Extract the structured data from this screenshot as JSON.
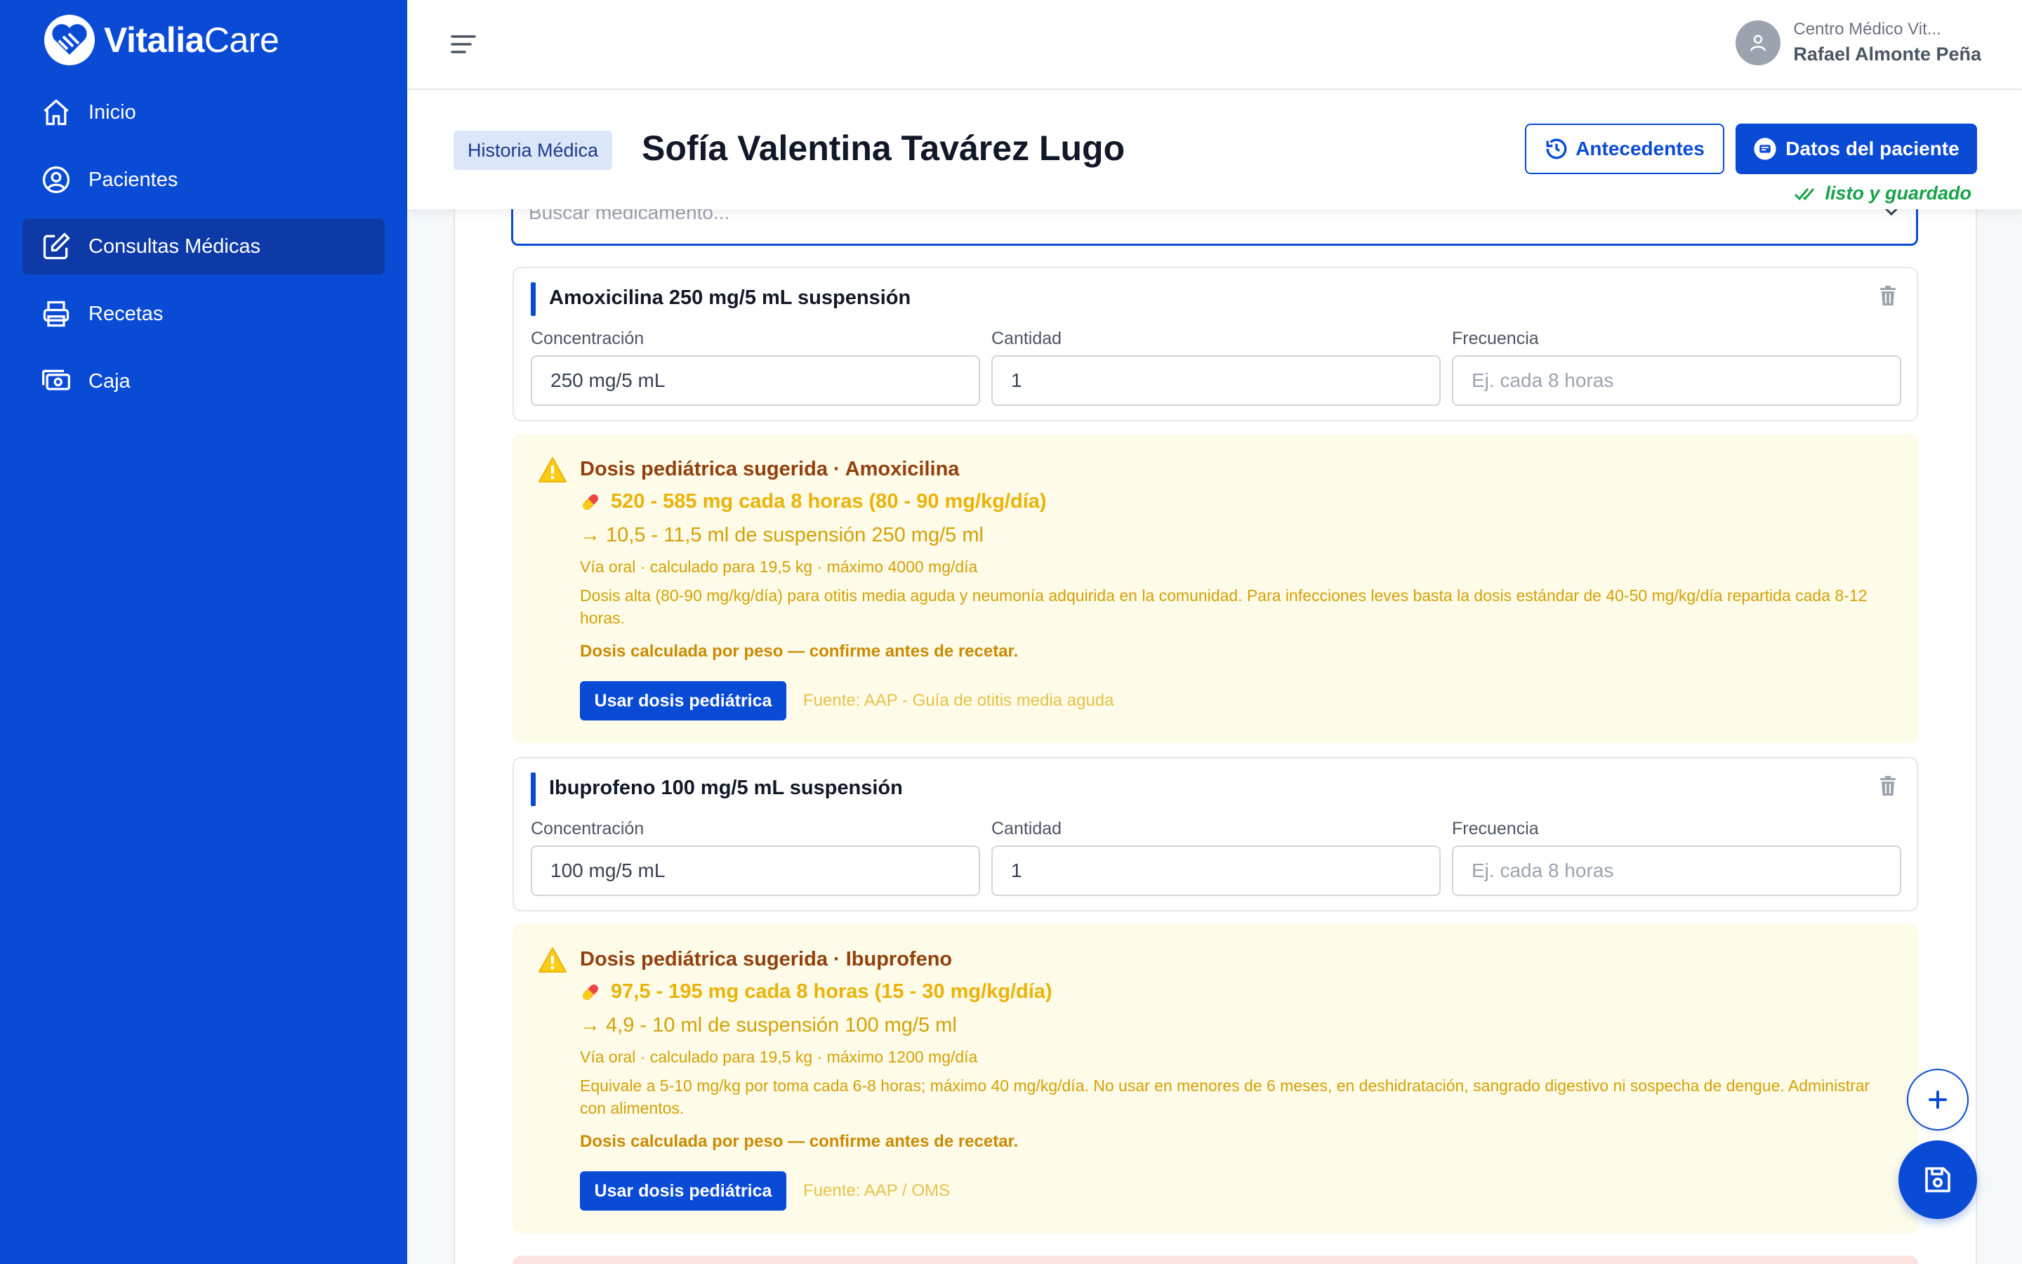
{
  "brand": {
    "name_bold": "Vitalia",
    "name_light": "Care"
  },
  "sidebar": {
    "items": [
      {
        "label": "Inicio",
        "icon": "home-icon"
      },
      {
        "label": "Pacientes",
        "icon": "user-circle-icon"
      },
      {
        "label": "Consultas Médicas",
        "icon": "edit-icon",
        "active": true
      },
      {
        "label": "Recetas",
        "icon": "printer-icon"
      },
      {
        "label": "Caja",
        "icon": "cash-icon"
      }
    ]
  },
  "header": {
    "clinic": "Centro Médico Vit...",
    "user": "Rafael Almonte Peña"
  },
  "patient": {
    "badge": "Historia Médica",
    "name": "Sofía Valentina Tavárez Lugo",
    "btn_history": "Antecedentes",
    "btn_data": "Datos del paciente",
    "status": "listo y guardado"
  },
  "search": {
    "placeholder": "Buscar medicamento..."
  },
  "labels": {
    "concentration": "Concentración",
    "quantity": "Cantidad",
    "frequency": "Frecuencia"
  },
  "medications": [
    {
      "title": "Amoxicilina 250 mg/5 mL suspensión",
      "concentration": "250 mg/5 mL",
      "quantity": "1",
      "frequency_placeholder": "Ej. cada 8 horas",
      "dose": {
        "title": "Dosis pediátrica sugerida · Amoxicilina",
        "main": "520 - 585 mg cada 8 horas (80 - 90 mg/kg/día)",
        "ml": "→ 10,5 - 11,5 ml de suspensión 250 mg/5 ml",
        "via": "Vía oral · calculado para 19,5 kg · máximo 4000 mg/día",
        "note": "Dosis alta (80-90 mg/kg/día) para otitis media aguda y neumonía adquirida en la comunidad. Para infecciones leves basta la dosis estándar de 40-50 mg/kg/día repartida cada 8-12 horas.",
        "confirm": "Dosis calculada por peso — confirme antes de recetar.",
        "button": "Usar dosis pediátrica",
        "source": "Fuente: AAP - Guía de otitis media aguda"
      }
    },
    {
      "title": "Ibuprofeno 100 mg/5 mL suspensión",
      "concentration": "100 mg/5 mL",
      "quantity": "1",
      "frequency_placeholder": "Ej. cada 8 horas",
      "dose": {
        "title": "Dosis pediátrica sugerida · Ibuprofeno",
        "main": "97,5 - 195 mg cada 8 horas (15 - 30 mg/kg/día)",
        "ml": "→ 4,9 - 10 ml de suspensión 100 mg/5 ml",
        "via": "Vía oral · calculado para 19,5 kg · máximo 1200 mg/día",
        "note": "Equivale a 5-10 mg/kg por toma cada 6-8 horas; máximo 40 mg/kg/día. No usar en menores de 6 meses, en deshidratación, sangrado digestivo ni sospecha de dengue. Administrar con alimentos.",
        "confirm": "Dosis calculada por peso — confirme antes de recetar.",
        "button": "Usar dosis pediátrica",
        "source": "Fuente: AAP / OMS"
      }
    }
  ],
  "colors": {
    "primary": "#0a4bd6",
    "active_nav": "#0d3aa7",
    "warning_bg": "#fefbe8",
    "success": "#16a34a"
  }
}
